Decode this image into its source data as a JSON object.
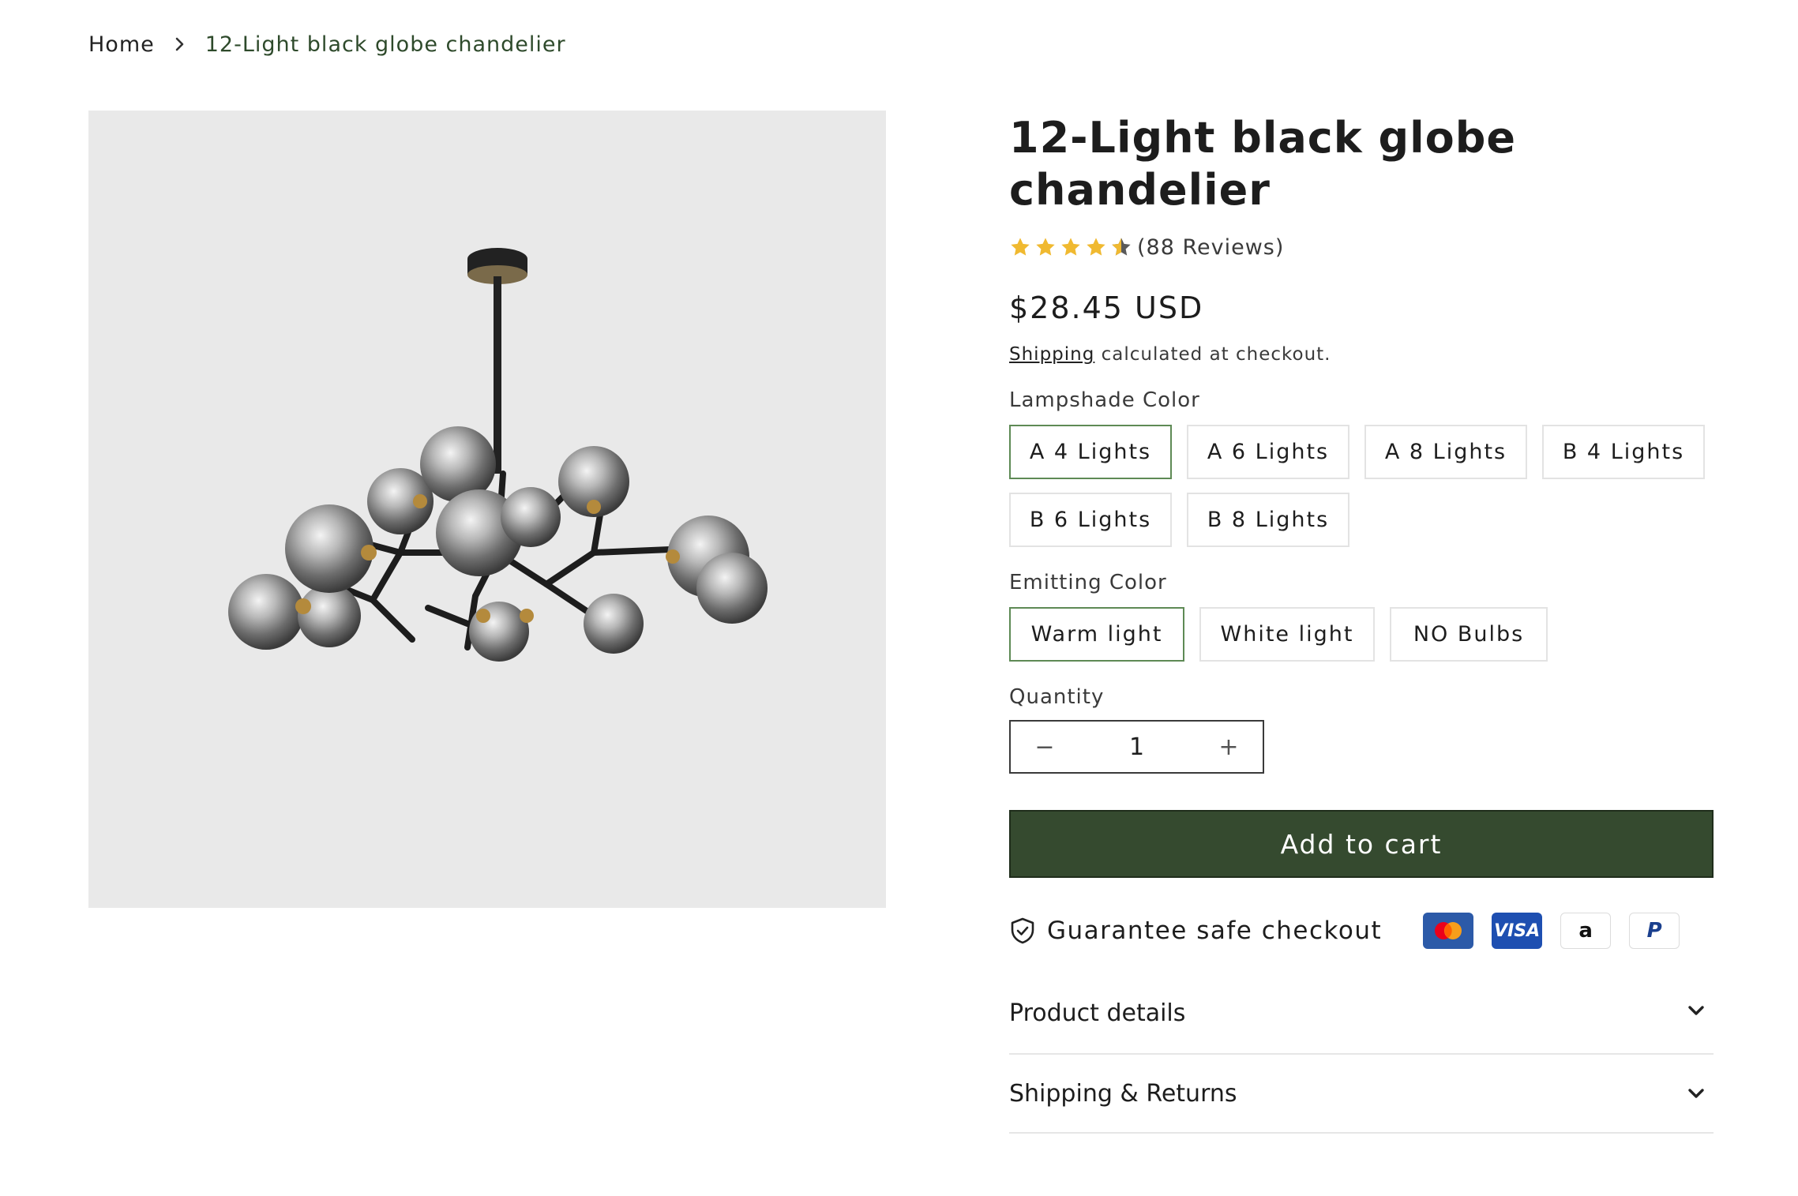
{
  "breadcrumb": {
    "home": "Home",
    "current": "12-Light black globe chandelier"
  },
  "product": {
    "title": "12-Light black globe chandelier",
    "rating": 4.5,
    "reviews": "(88 Reviews)",
    "price": "$28.45 USD",
    "shipping_link": "Shipping",
    "shipping_note": " calculated at checkout."
  },
  "options": {
    "lampshade_label": "Lampshade Color",
    "lampshade": [
      "A 4 Lights",
      "A 6 Lights",
      "A 8 Lights",
      "B 4 Lights",
      "B 6 Lights",
      "B 8 Lights"
    ],
    "lampshade_selected": "A 4 Lights",
    "emitting_label": "Emitting Color",
    "emitting": [
      "Warm light",
      "White light",
      "NO Bulbs"
    ],
    "emitting_selected": "Warm light"
  },
  "quantity": {
    "label": "Quantity",
    "value": "1",
    "minus": "−",
    "plus": "+"
  },
  "cart": {
    "label": "Add to cart"
  },
  "guarantee": {
    "text": "Guarantee safe checkout",
    "payment_icons": [
      "mastercard-icon",
      "visa-icon",
      "amazon-icon",
      "paypal-icon"
    ],
    "visa": "VISA",
    "amazon": "a",
    "paypal": "P"
  },
  "accordion": [
    {
      "title": "Product details"
    },
    {
      "title": "Shipping & Returns"
    }
  ],
  "colors": {
    "accent": "#354a2f",
    "selected_border": "#5e8a55",
    "star": "#f0b930",
    "breadcrumb_current": "#2e4a2b"
  }
}
